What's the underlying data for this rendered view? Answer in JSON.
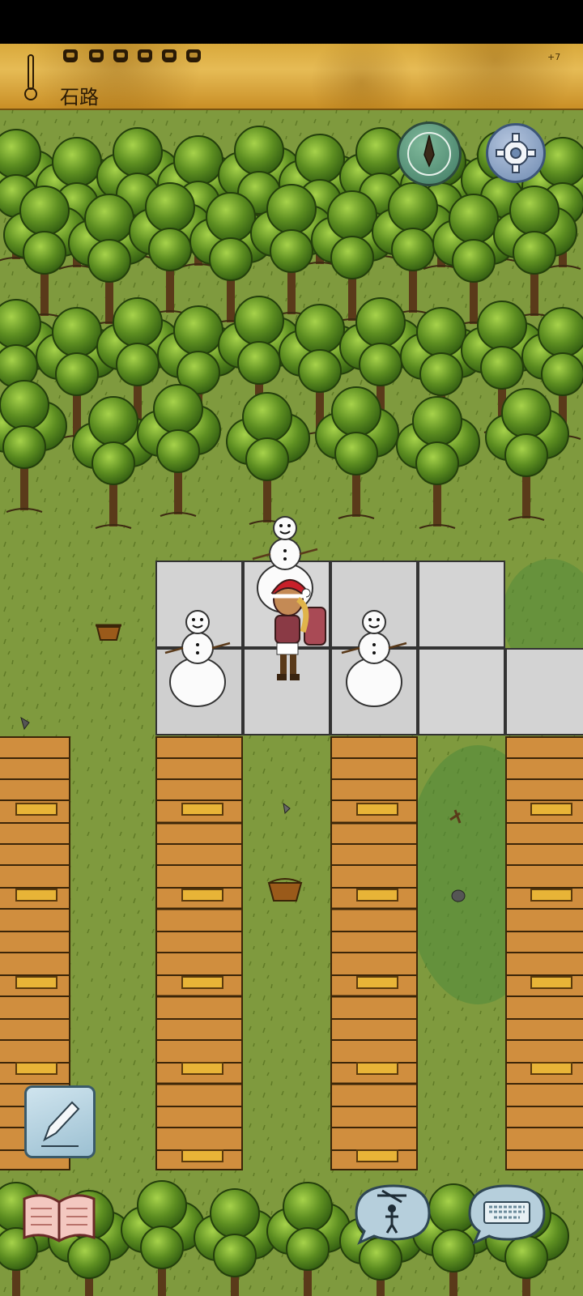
{
  "hud": {
    "location": "石路",
    "meter_label": "+7",
    "food_pips": 6,
    "thermometer_icon": "thermometer-icon"
  },
  "buttons": {
    "compass": "compass-icon",
    "settings": "gear-icon",
    "pencil": "pencil-icon",
    "tech_book": "book-icon",
    "puppet_emote": "puppet-icon",
    "keyboard_chat": "keyboard-icon"
  },
  "scene": {
    "tile_types": [
      "grass",
      "stone-road",
      "wood-floor",
      "forest"
    ],
    "objects": [
      "snowman",
      "snowman",
      "snowman",
      "player-with-santa-hat",
      "basket",
      "basket",
      "stone",
      "flint",
      "twig"
    ]
  },
  "colors": {
    "grass": "#7f9a3e",
    "tree_leaf": "#5d8e21",
    "stone_tile": "#d3d3d3",
    "wood_tile": "#d08e3e",
    "hud_parchment": "#e0b14c"
  }
}
